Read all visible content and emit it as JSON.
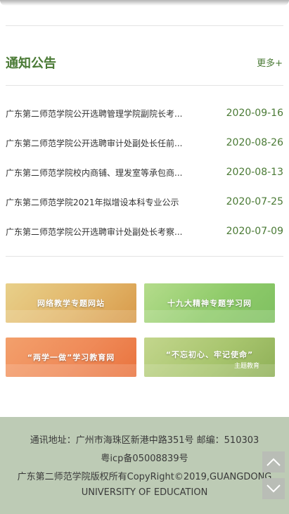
{
  "notices": {
    "title": "通知公告",
    "more_label": "更多+",
    "items": [
      {
        "title": "广东第二师范学院公开选聘管理学院副院长考...",
        "date": "2020-09-16"
      },
      {
        "title": "广东第二师范学院公开选聘审计处副处长任前...",
        "date": "2020-08-26"
      },
      {
        "title": "广东第二师范学院校内商铺、理发室等承包商...",
        "date": "2020-08-13"
      },
      {
        "title": "广东第二师范学院2021年拟增设本科专业公示",
        "date": "2020-07-25"
      },
      {
        "title": "广东第二师范学院公开选聘审计处副处长考察...",
        "date": "2020-07-09"
      }
    ]
  },
  "banners": [
    {
      "label": "网络教学专题网站"
    },
    {
      "label": "十九大精神专题学习网"
    },
    {
      "label": "“两学一做”学习教育网"
    },
    {
      "label": "“不忘初心、牢记使命”",
      "sub": "主题教育"
    }
  ],
  "footer": {
    "address": "通讯地址：广州市海珠区新港中路351号  邮编：510303",
    "icp": "粤icp备05008839号",
    "copyright_1": "广东第二师范学院版权所有CopyRight©2019,GUANGDONG",
    "copyright_2": "UNIVERSITY OF EDUCATION"
  },
  "icons": {
    "scroll_up": "chevron-up-icon",
    "scroll_down": "chevron-down-icon"
  }
}
